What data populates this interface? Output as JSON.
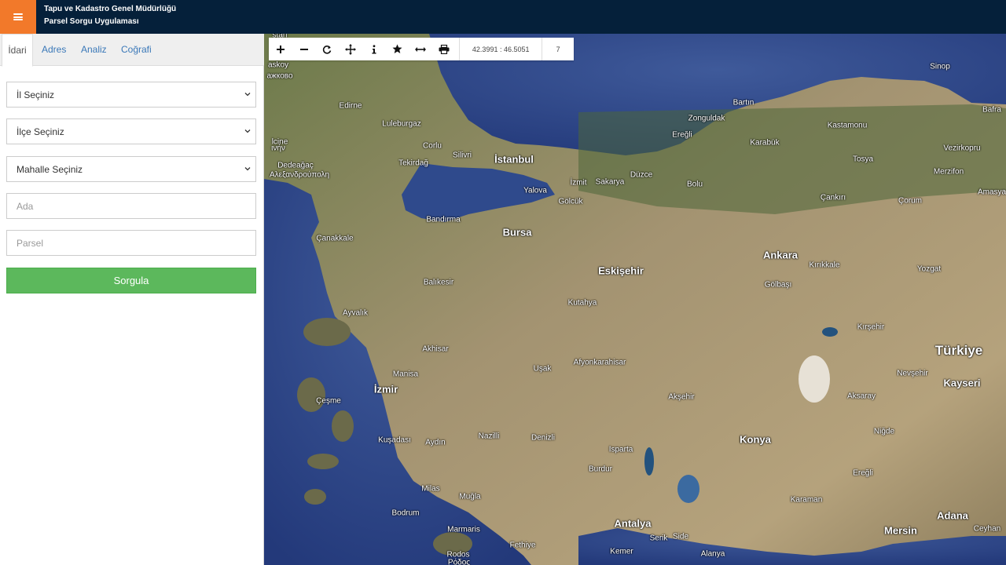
{
  "header": {
    "title_line1": "Tapu ve Kadastro Genel Müdürlüğü",
    "title_line2": "Parsel Sorgu Uygulaması",
    "menu_icon": "hamburger-icon",
    "accent_color": "#f2792a",
    "bar_color": "#05203a"
  },
  "panel": {
    "tabs": [
      {
        "label": "İdari",
        "active": true
      },
      {
        "label": "Adres",
        "active": false
      },
      {
        "label": "Analiz",
        "active": false
      },
      {
        "label": "Coğrafi",
        "active": false
      }
    ],
    "il_select": "İl Seçiniz",
    "ilce_select": "İlçe Seçiniz",
    "mahalle_select": "Mahalle Seçiniz",
    "ada_placeholder": "Ada",
    "parsel_placeholder": "Parsel",
    "query_button": "Sorgula",
    "button_color": "#5cb85c"
  },
  "toolbar": {
    "tools": [
      "zoom-in-icon",
      "zoom-out-icon",
      "refresh-icon",
      "move-icon",
      "info-icon",
      "star-icon",
      "measure-icon",
      "print-icon"
    ],
    "coordinates": "42.3991 : 46.5051",
    "zoom_level": "7"
  },
  "map": {
    "labels": [
      {
        "text": "stan"
      },
      {
        "text": "askoy"
      },
      {
        "text": "ажково"
      },
      {
        "text": "Edirne"
      },
      {
        "text": "Luleburgaz"
      },
      {
        "text": "lcine"
      },
      {
        "text": "ινήν"
      },
      {
        "text": "Corlu"
      },
      {
        "text": "Silivri"
      },
      {
        "text": "İstanbul"
      },
      {
        "text": "Dedeağaç"
      },
      {
        "text": "Αλεξανδρούπολη"
      },
      {
        "text": "Tekirdağ"
      },
      {
        "text": "Yalova"
      },
      {
        "text": "İzmit"
      },
      {
        "text": "Sakarya"
      },
      {
        "text": "Düzce"
      },
      {
        "text": "Bolu"
      },
      {
        "text": "Gölcük"
      },
      {
        "text": "Bandırma"
      },
      {
        "text": "Bursa"
      },
      {
        "text": "Çanakkale"
      },
      {
        "text": "Sinop"
      },
      {
        "text": "Bartın"
      },
      {
        "text": "Bafra"
      },
      {
        "text": "Zonguldak"
      },
      {
        "text": "Kastamonu"
      },
      {
        "text": "Ereğli"
      },
      {
        "text": "Karabük"
      },
      {
        "text": "Vezirkopru"
      },
      {
        "text": "Tosya"
      },
      {
        "text": "Merzifon"
      },
      {
        "text": "Amasya"
      },
      {
        "text": "Çankırı"
      },
      {
        "text": "Çorum"
      },
      {
        "text": "Ankara"
      },
      {
        "text": "Kırıkkale"
      },
      {
        "text": "Yozgat"
      },
      {
        "text": "Gölbaşı"
      },
      {
        "text": "Eskişehir"
      },
      {
        "text": "Balıkesir"
      },
      {
        "text": "Kutahya"
      },
      {
        "text": "Ayvalık"
      },
      {
        "text": "Akhisar"
      },
      {
        "text": "Kırşehir"
      },
      {
        "text": "Türkiye"
      },
      {
        "text": "Manisa"
      },
      {
        "text": "Uşak"
      },
      {
        "text": "Afyonkarahisar"
      },
      {
        "text": "Nevşehir"
      },
      {
        "text": "Kayseri"
      },
      {
        "text": "İzmir"
      },
      {
        "text": "Çeşme"
      },
      {
        "text": "Akşehir"
      },
      {
        "text": "Aksaray"
      },
      {
        "text": "Kuşadası"
      },
      {
        "text": "Aydın"
      },
      {
        "text": "Nazilli"
      },
      {
        "text": "Denizli"
      },
      {
        "text": "Niğde"
      },
      {
        "text": "Konya"
      },
      {
        "text": "Isparta"
      },
      {
        "text": "Burdur"
      },
      {
        "text": "Ereğli"
      },
      {
        "text": "Milas"
      },
      {
        "text": "Muğla"
      },
      {
        "text": "Karaman"
      },
      {
        "text": "Bodrum"
      },
      {
        "text": "Antalya"
      },
      {
        "text": "Adana"
      },
      {
        "text": "Marmaris"
      },
      {
        "text": "Serik"
      },
      {
        "text": "Side"
      },
      {
        "text": "Mersin"
      },
      {
        "text": "Ceyhan"
      },
      {
        "text": "Fethiye"
      },
      {
        "text": "Rodos"
      },
      {
        "text": "Ρόδος"
      },
      {
        "text": "Kemer"
      },
      {
        "text": "Alanya"
      }
    ]
  }
}
